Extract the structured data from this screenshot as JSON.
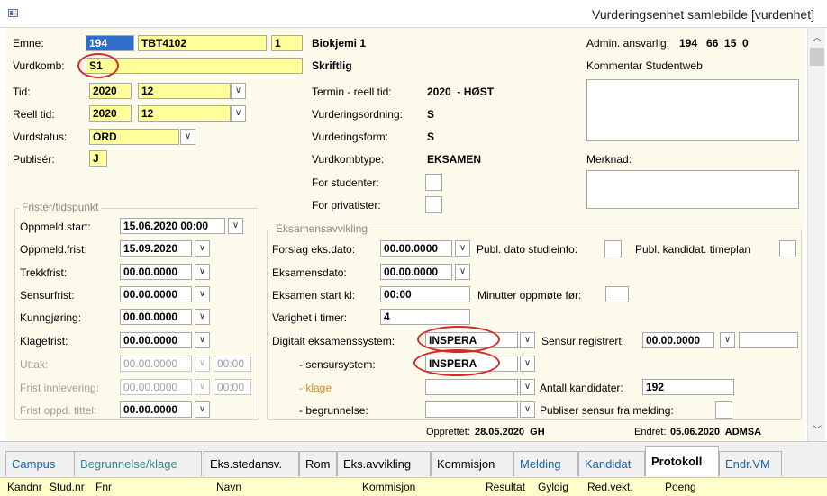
{
  "window": {
    "title": "Vurderingsenhet samlebilde [vurdenhet]"
  },
  "emne": {
    "label": "Emne:",
    "inst": "194",
    "code": "TBT4102",
    "version": "1",
    "name": "Biokjemi 1"
  },
  "admin": {
    "label": "Admin. ansvarlig:",
    "values": "194   66  15  0"
  },
  "vurdkomb": {
    "label": "Vurdkomb:",
    "value": "S1",
    "desc": "Skriftlig"
  },
  "comments": {
    "studentweb_label": "Kommentar Studentweb",
    "merknad_label": "Merknad:"
  },
  "tid": {
    "label": "Tid:",
    "year": "2020",
    "month": "12"
  },
  "termin": {
    "label": "Termin - reell tid:",
    "value": "2020  - HØST"
  },
  "reell_tid": {
    "label": "Reell tid:",
    "year": "2020",
    "month": "12"
  },
  "vurderingsordning": {
    "label": "Vurderingsordning:",
    "value": "S"
  },
  "vurdstatus": {
    "label": "Vurdstatus:",
    "value": "ORD"
  },
  "vurderingsform": {
    "label": "Vurderingsform:",
    "value": "S"
  },
  "publiser": {
    "label": "Publisér:",
    "value": "J"
  },
  "vurdkombtype": {
    "label": "Vurdkombtype:",
    "value": "EKSAMEN"
  },
  "for_studenter": {
    "label": "For studenter:"
  },
  "for_privatister": {
    "label": "For privatister:"
  },
  "frister": {
    "title": "Frister/tidspunkt",
    "oppmeld_start": {
      "label": "Oppmeld.start:",
      "value": "15.06.2020 00:00"
    },
    "oppmeld_frist": {
      "label": "Oppmeld.frist:",
      "value": "15.09.2020"
    },
    "trekkfrist": {
      "label": "Trekkfrist:",
      "value": "00.00.0000"
    },
    "sensurfrist": {
      "label": "Sensurfrist:",
      "value": "00.00.0000"
    },
    "kunngjoring": {
      "label": "Kunngjøring:",
      "value": "00.00.0000"
    },
    "klagefrist": {
      "label": "Klagefrist:",
      "value": "00.00.0000"
    },
    "uttak": {
      "label": "Uttak:",
      "date": "00.00.0000",
      "time": "00:00"
    },
    "frist_innlevering": {
      "label": "Frist innlevering:",
      "date": "00.00.0000",
      "time": "00:00"
    },
    "frist_oppd_tittel": {
      "label": "Frist oppd. tittel:",
      "value": "00.00.0000"
    }
  },
  "eksamen": {
    "title": "Eksamensavvikling",
    "forslag_dato": {
      "label": "Forslag eks.dato:",
      "value": "00.00.0000"
    },
    "publ_dato_label": "Publ. dato studieinfo:",
    "publ_kandidat_label": "Publ. kandidat. timeplan",
    "eksamensdato": {
      "label": "Eksamensdato:",
      "value": "00.00.0000"
    },
    "start_kl": {
      "label": "Eksamen start kl:",
      "value": "00:00"
    },
    "minutter_label": "Minutter oppmøte før:",
    "varighet": {
      "label": "Varighet i timer:",
      "value": "4"
    },
    "digitalt": {
      "label": "Digitalt eksamenssystem:",
      "value": "INSPERA"
    },
    "sensur_registrert": {
      "label": "Sensur registrert:",
      "value": "00.00.0000"
    },
    "sensursystem": {
      "label": "- sensursystem:",
      "value": "INSPERA"
    },
    "klage_label": "- klage",
    "antall": {
      "label": "Antall kandidater:",
      "value": "192"
    },
    "begrunnelse_label": "- begrunnelse:",
    "publiser_sensur_label": "Publiser sensur fra melding:"
  },
  "footer": {
    "opprettet_label": "Opprettet:",
    "opprettet_value": "28.05.2020  GH",
    "endret_label": "Endret:",
    "endret_value": "05.06.2020  ADMSA"
  },
  "tabs": [
    "Campus",
    "Begrunnelse/klage",
    "Eks.stedansv.",
    "Rom",
    "Eks.avvikling",
    "Kommisjon",
    "Melding",
    "Kandidat",
    "Protokoll",
    "Endr.VM"
  ],
  "table_header": [
    "Kandnr",
    "Stud.nr",
    "Fnr",
    "Navn",
    "Kommisjon",
    "Resultat",
    "Gyldig",
    "Red.vekt.",
    "Poeng"
  ],
  "colors": {
    "field_yellow": "#ffff99",
    "form_bg": "#fbfaeb",
    "highlight_red": "#d62828",
    "tab_blue": "#1464b4"
  }
}
